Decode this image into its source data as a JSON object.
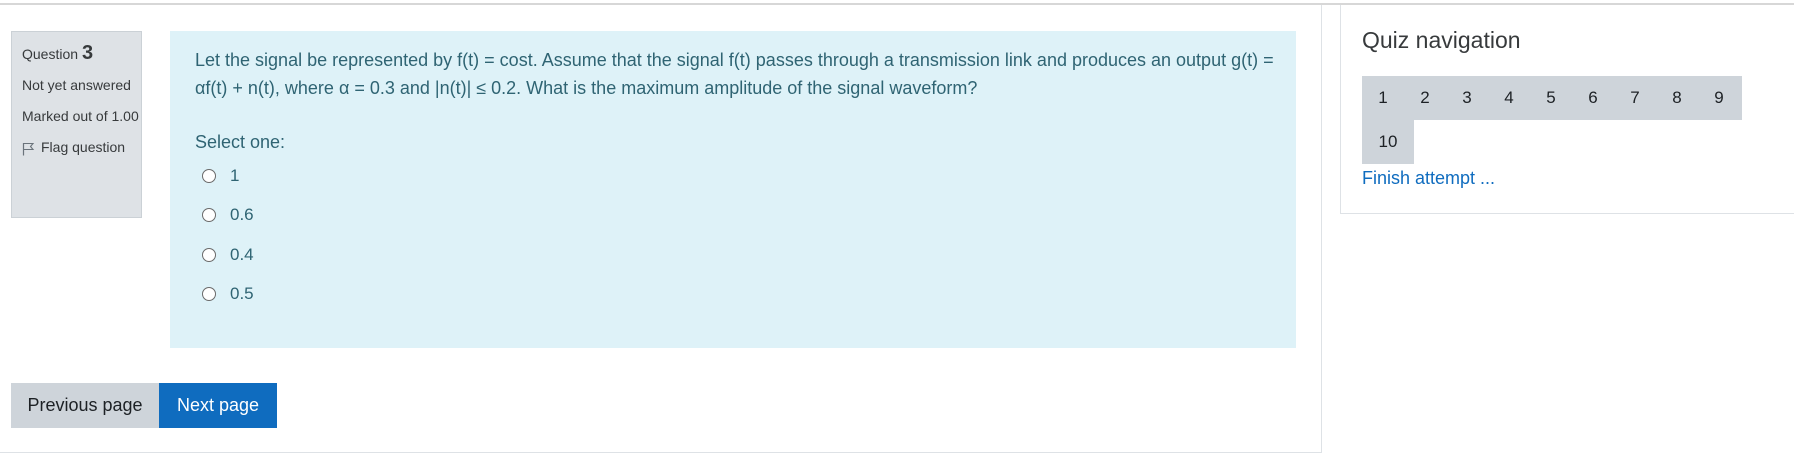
{
  "question_info": {
    "label": "Question",
    "number": "3",
    "state": "Not yet answered",
    "grade": "Marked out of 1.00",
    "flag_label": "Flag question"
  },
  "question": {
    "text": "Let the signal be represented by f(t) = cost. Assume that the signal f(t) passes through a transmission link and produces an output g(t) = αf(t) + n(t), where α = 0.3 and |n(t)| ≤ 0.2. What is the maximum amplitude of the signal waveform?",
    "prompt": "Select one:",
    "options": [
      "1",
      "0.6",
      "0.4",
      "0.5"
    ]
  },
  "buttons": {
    "previous": "Previous page",
    "next": "Next page"
  },
  "quiz_nav": {
    "title": "Quiz navigation",
    "pages": [
      "1",
      "2",
      "3",
      "4",
      "5",
      "6",
      "7",
      "8",
      "9",
      "10"
    ],
    "finish": "Finish attempt ..."
  },
  "colors": {
    "formulation_bg": "#def2f8",
    "info_bg": "#dee2e6",
    "primary": "#0f6cbf",
    "secondary": "#ced4da"
  },
  "icons": {
    "flag": "flag-icon",
    "radio": "radio-unchecked"
  }
}
